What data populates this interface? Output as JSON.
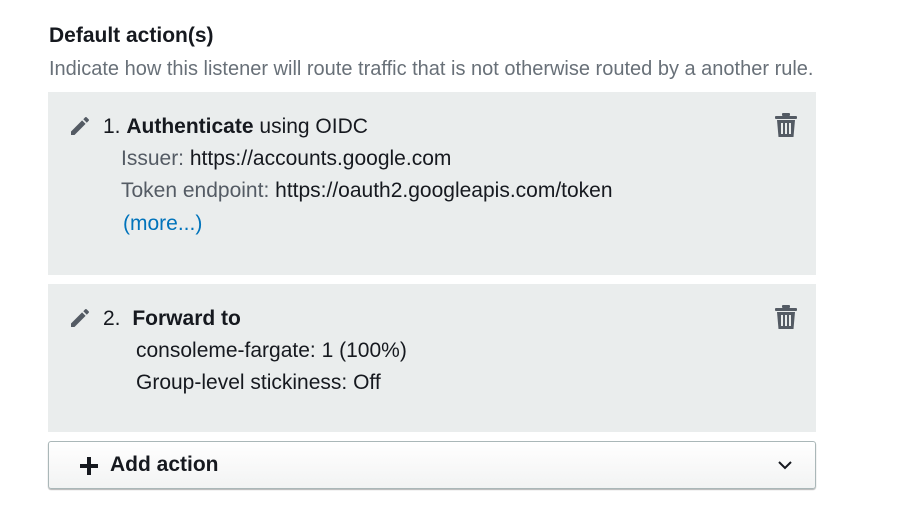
{
  "section": {
    "title": "Default action(s)",
    "description": "Indicate how this listener will route traffic that is not otherwise routed by a another rule."
  },
  "actions": [
    {
      "number": "1.",
      "type": "Authenticate",
      "type_suffix": "using OIDC",
      "fields": [
        {
          "label": "Issuer:",
          "value": "https://accounts.google.com"
        },
        {
          "label": "Token endpoint:",
          "value": "https://oauth2.googleapis.com/token"
        }
      ],
      "more_link": "(more...)",
      "icons": {
        "edit": "pencil-icon",
        "delete": "trash-icon"
      }
    },
    {
      "number": "2.",
      "type": "Forward to",
      "lines": [
        "consoleme-fargate: 1 (100%)",
        "Group-level stickiness: Off"
      ],
      "icons": {
        "edit": "pencil-icon",
        "delete": "trash-icon"
      }
    }
  ],
  "add_action": {
    "label": "Add action",
    "icons": {
      "left": "plus-icon",
      "right": "chevron-down-icon"
    }
  },
  "colors": {
    "card_background": "#eaeded",
    "link": "#0073bb",
    "description_text": "#687078"
  }
}
